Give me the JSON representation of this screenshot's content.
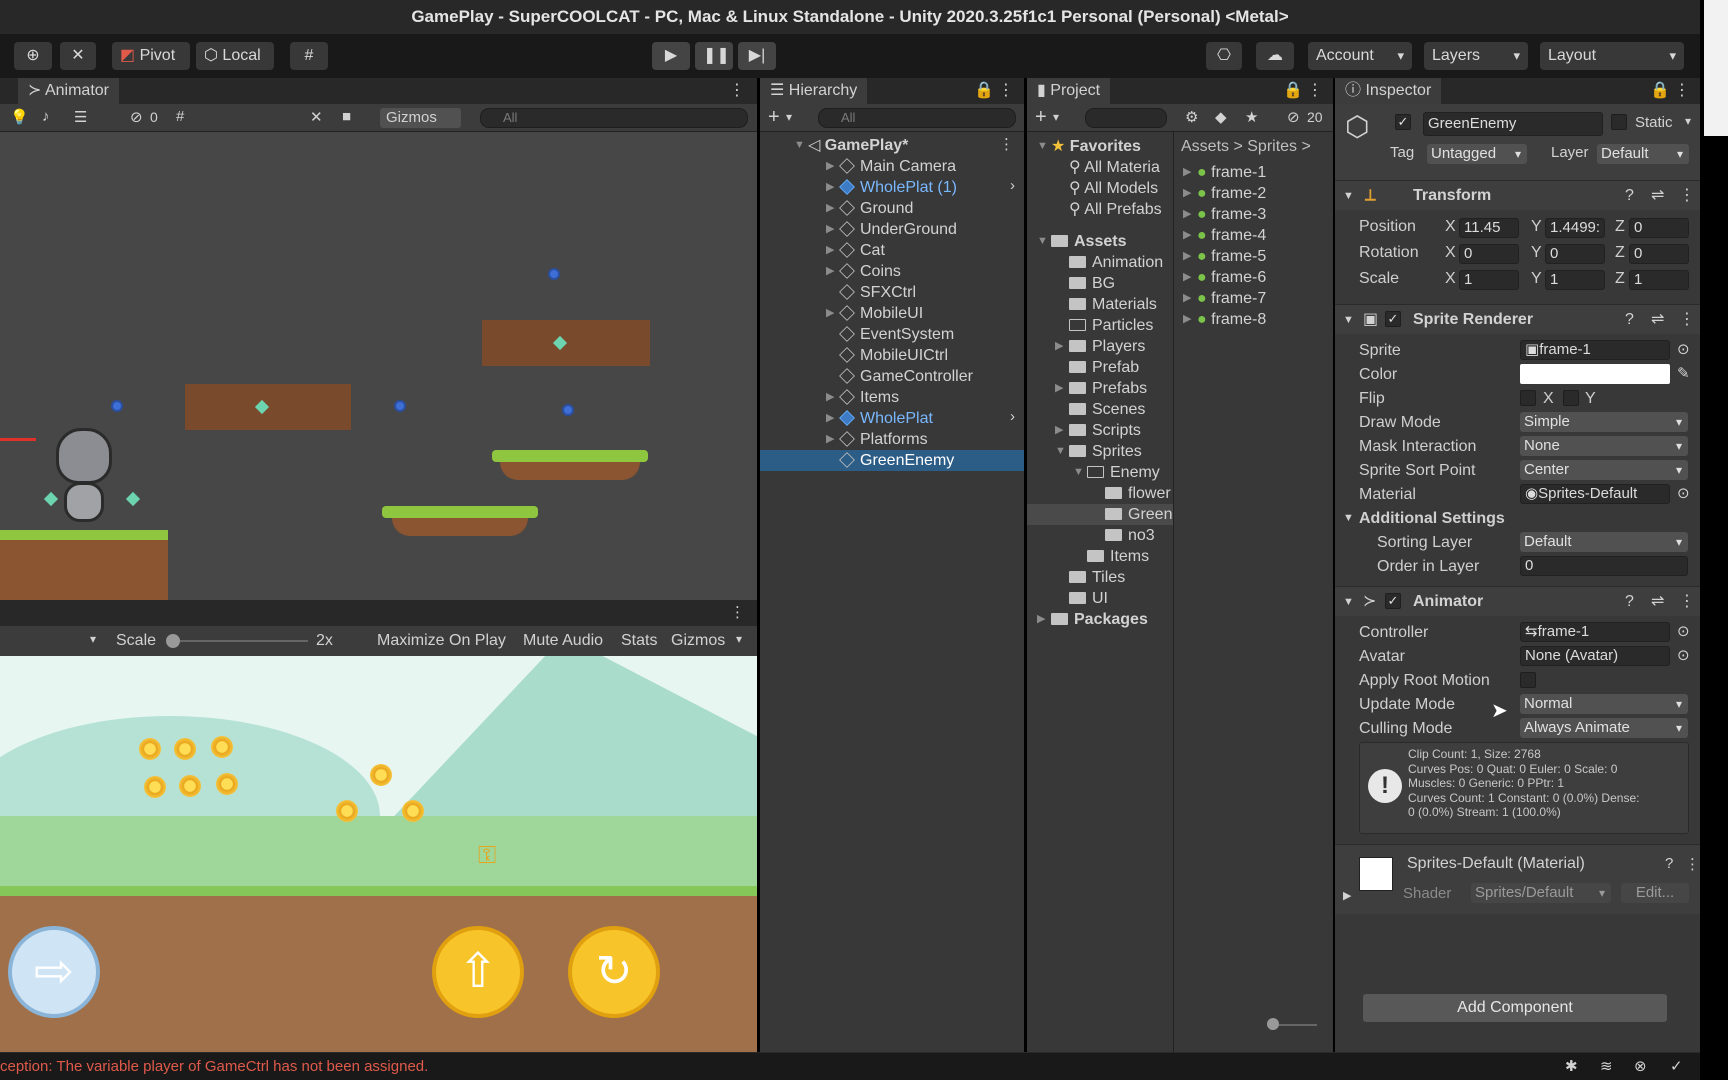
{
  "window": {
    "title": "GamePlay - SuperCOOLCAT - PC, Mac & Linux Standalone - Unity 2020.3.25f1c1 Personal (Personal) <Metal>"
  },
  "toolbar": {
    "pivot": "Pivot",
    "local": "Local",
    "account": "Account",
    "layers": "Layers",
    "layout": "Layout"
  },
  "scene": {
    "tab": "Animator",
    "hidden_count": "0",
    "gizmos": "Gizmos",
    "search_placeholder": "All"
  },
  "game": {
    "scale_label": "Scale",
    "scale_value": "2x",
    "maximize": "Maximize On Play",
    "mute": "Mute Audio",
    "stats": "Stats",
    "gizmos": "Gizmos"
  },
  "hierarchy": {
    "tab": "Hierarchy",
    "search_placeholder": "All",
    "root": "GamePlay*",
    "items": [
      {
        "label": "Main Camera"
      },
      {
        "label": "WholePlat (1)"
      },
      {
        "label": "Ground"
      },
      {
        "label": "UnderGround"
      },
      {
        "label": "Cat"
      },
      {
        "label": "Coins"
      },
      {
        "label": "SFXCtrl"
      },
      {
        "label": "MobileUI"
      },
      {
        "label": "EventSystem"
      },
      {
        "label": "MobileUICtrl"
      },
      {
        "label": "GameController"
      },
      {
        "label": "Items"
      },
      {
        "label": "WholePlat"
      },
      {
        "label": "Platforms"
      },
      {
        "label": "GreenEnemy"
      }
    ]
  },
  "project": {
    "tab": "Project",
    "hidden_count": "20",
    "favorites": "Favorites",
    "fav_items": [
      "All Materia",
      "All Models",
      "All Prefabs"
    ],
    "assets": "Assets",
    "asset_items": [
      "Animation",
      "BG",
      "Materials",
      "Particles",
      "Players",
      "Prefab",
      "Prefabs",
      "Scenes",
      "Scripts",
      "Sprites",
      "Enemy",
      "flower",
      "Green",
      "no3",
      "Items",
      "Tiles",
      "UI"
    ],
    "packages": "Packages",
    "breadcrumb": [
      "Assets",
      "Sprites"
    ],
    "frames": [
      "frame-1",
      "frame-2",
      "frame-3",
      "frame-4",
      "frame-5",
      "frame-6",
      "frame-7",
      "frame-8"
    ]
  },
  "inspector": {
    "tab": "Inspector",
    "name": "GreenEnemy",
    "static": "Static",
    "tag_label": "Tag",
    "tag": "Untagged",
    "layer_label": "Layer",
    "layer": "Default",
    "transform": {
      "title": "Transform",
      "position": "Position",
      "rotation": "Rotation",
      "scale": "Scale",
      "x_lbl": "X",
      "y_lbl": "Y",
      "z_lbl": "Z",
      "pos": [
        "11.45",
        "1.4499:",
        "0"
      ],
      "rot": [
        "0",
        "0",
        "0"
      ],
      "scl": [
        "1",
        "1",
        "1"
      ]
    },
    "sprite_renderer": {
      "title": "Sprite Renderer",
      "sprite_label": "Sprite",
      "sprite": "frame-1",
      "color_label": "Color",
      "flip_label": "Flip",
      "flip_x": "X",
      "flip_y": "Y",
      "draw_mode_label": "Draw Mode",
      "draw_mode": "Simple",
      "mask_label": "Mask Interaction",
      "mask": "None",
      "sort_point_label": "Sprite Sort Point",
      "sort_point": "Center",
      "material_label": "Material",
      "material": "Sprites-Default",
      "additional": "Additional Settings",
      "sorting_layer_label": "Sorting Layer",
      "sorting_layer": "Default",
      "order_label": "Order in Layer",
      "order": "0"
    },
    "animator": {
      "title": "Animator",
      "controller_label": "Controller",
      "controller": "frame-1",
      "avatar_label": "Avatar",
      "avatar": "None (Avatar)",
      "root_motion_label": "Apply Root Motion",
      "update_label": "Update Mode",
      "update": "Normal",
      "culling_label": "Culling Mode",
      "culling": "Always Animate",
      "info": [
        "Clip Count: 1, Size: 2768",
        "Curves Pos: 0 Quat: 0 Euler: 0 Scale: 0",
        "Muscles: 0 Generic: 0 PPtr: 1",
        "Curves Count: 1 Constant: 0 (0.0%) Dense:",
        "0 (0.0%) Stream: 1 (100.0%)"
      ]
    },
    "material": {
      "title": "Sprites-Default (Material)",
      "shader_label": "Shader",
      "shader": "Sprites/Default",
      "edit": "Edit..."
    },
    "add_component": "Add Component"
  },
  "status": {
    "message": "ception: The variable player of GameCtrl has not been assigned."
  },
  "colors": {
    "selection": "#2c5d87",
    "blue_text": "#79b8ff",
    "error_text": "#e05a4a"
  }
}
